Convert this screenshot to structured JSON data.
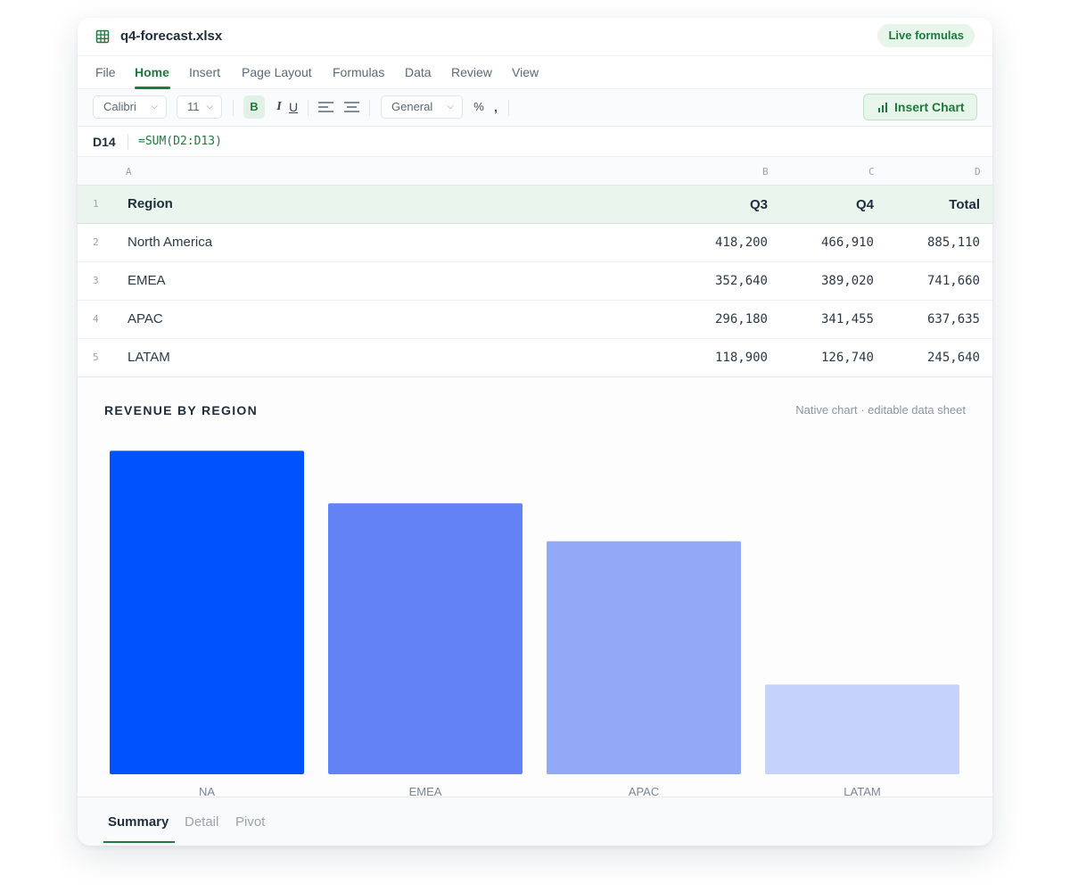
{
  "window": {
    "file_name": "q4-forecast.xlsx",
    "badge": "Live formulas",
    "file_icon": "spreadsheet-grid-icon"
  },
  "menu": {
    "items": [
      "File",
      "Home",
      "Insert",
      "Page Layout",
      "Formulas",
      "Data",
      "Review",
      "View"
    ],
    "active": "Home"
  },
  "toolbar": {
    "font": "Calibri",
    "size": "11",
    "bold": "B",
    "italic": "I",
    "underline": "U",
    "number_format": "General",
    "percent": "%",
    "comma": ",",
    "insert_chart": "Insert Chart",
    "insert_chart_icon": "bar-chart-icon"
  },
  "formula_bar": {
    "cell_ref": "D14",
    "formula": "=SUM(D2:D13)"
  },
  "grid": {
    "columns": [
      "A",
      "B",
      "C",
      "D"
    ],
    "rows": [
      {
        "n": "1",
        "a": "Region",
        "b": "Q3",
        "c": "Q4",
        "d": "Total"
      },
      {
        "n": "2",
        "a": "North America",
        "b": "418,200",
        "c": "466,910",
        "d": "885,110"
      },
      {
        "n": "3",
        "a": "EMEA",
        "b": "352,640",
        "c": "389,020",
        "d": "741,660"
      },
      {
        "n": "4",
        "a": "APAC",
        "b": "296,180",
        "c": "341,455",
        "d": "637,635"
      },
      {
        "n": "5",
        "a": "LATAM",
        "b": "118,900",
        "c": "126,740",
        "d": "245,640"
      }
    ]
  },
  "chart_panel": {
    "title": "REVENUE BY REGION",
    "subtitle": "Native chart · editable data sheet"
  },
  "chart_data": {
    "type": "bar",
    "title": "REVENUE BY REGION",
    "categories": [
      "NA",
      "EMEA",
      "APAC",
      "LATAM"
    ],
    "values": [
      885110,
      741660,
      637635,
      245640
    ],
    "colors": [
      "#0052ff",
      "#6282f5",
      "#91a9f7",
      "#c5d3fa"
    ],
    "ylim": [
      0,
      935000
    ],
    "grid": false,
    "xlabel": "",
    "ylabel": ""
  },
  "sheets": {
    "tabs": [
      "Summary",
      "Detail",
      "Pivot"
    ],
    "active": "Summary"
  }
}
